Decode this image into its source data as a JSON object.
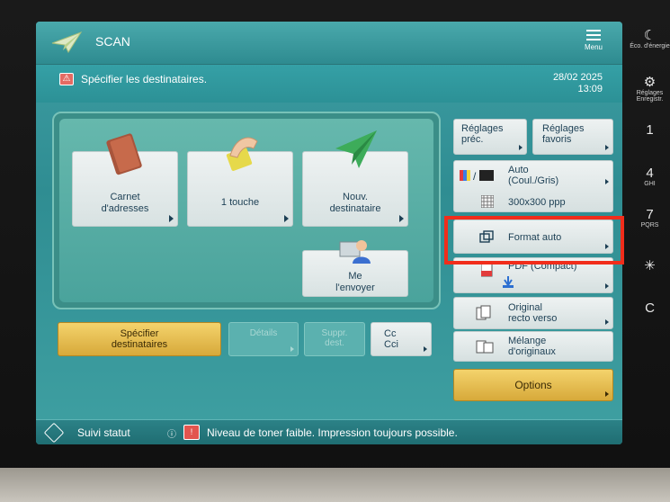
{
  "header": {
    "title": "SCAN",
    "menu_label": "Menu"
  },
  "message": {
    "text": "Spécifier les destinataires.",
    "date": "28/02 2025",
    "time": "13:09"
  },
  "address_tiles": {
    "carnet": [
      "Carnet",
      "d'adresses"
    ],
    "one_touch": "1 touche",
    "nouv": [
      "Nouv.",
      "destinataire"
    ],
    "me": [
      "Me",
      "l'envoyer"
    ]
  },
  "bottom_buttons": {
    "specifier": [
      "Spécifier",
      "destinataires"
    ],
    "details": "Détails",
    "suppr": [
      "Suppr.",
      "dest."
    ],
    "cc": [
      "Cc",
      "Cci"
    ]
  },
  "settings": {
    "reglages_prec": [
      "Réglages",
      "préc."
    ],
    "reglages_favoris": [
      "Réglages",
      "favoris"
    ],
    "color": [
      "Auto",
      "(Coul./Gris)"
    ],
    "resolution": "300x300 ppp",
    "format": "Format auto",
    "file_format": "PDF (Compact)",
    "original": [
      "Original",
      "recto verso"
    ],
    "melange": [
      "Mélange",
      "d'originaux"
    ],
    "options": "Options"
  },
  "status": {
    "suivi": "Suivi statut",
    "toner_msg": "Niveau de toner faible. Impression toujours possible."
  },
  "side_keys": {
    "eco": "Éco. d'énergie",
    "reglages_enreg": [
      "Réglages",
      "Enregistr."
    ],
    "k1": "1",
    "k4": "4",
    "k4_sub": "GHI",
    "k7": "7",
    "k7_sub": "PQRS",
    "star": "✳",
    "clear": "C"
  },
  "colors": {
    "accent": "#2e8b90",
    "highlight": "#f12d1b",
    "yellow": "#e0b447"
  }
}
